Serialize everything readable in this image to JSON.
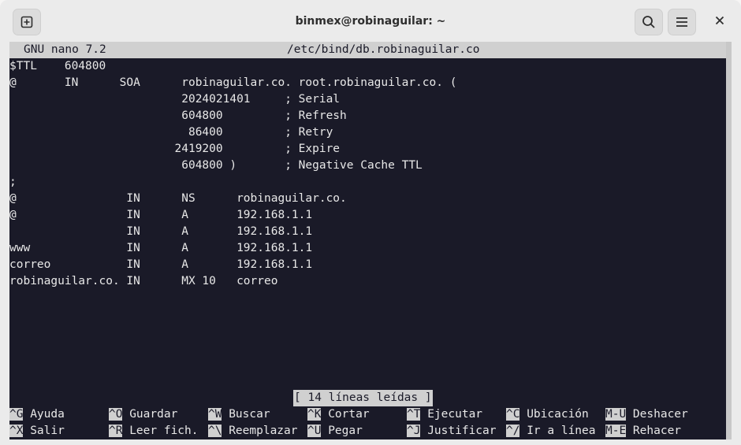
{
  "window": {
    "title": "binmex@robinaguilar: ~"
  },
  "icons": {
    "new_tab": "new-tab-icon",
    "search": "search-icon",
    "menu": "hamburger-menu-icon",
    "close": "close-icon"
  },
  "nano": {
    "version": "GNU nano 7.2",
    "filename": "/etc/bind/db.robinaguilar.co",
    "lines": [
      "$TTL    604800",
      "@       IN      SOA      robinaguilar.co. root.robinaguilar.co. (",
      "                         2024021401     ; Serial",
      "                         604800         ; Refresh",
      "                          86400         ; Retry",
      "                        2419200         ; Expire",
      "                         604800 )       ; Negative Cache TTL",
      ";",
      "@                IN      NS      robinaguilar.co.",
      "@                IN      A       192.168.1.1",
      "                 IN      A       192.168.1.1",
      "www              IN      A       192.168.1.1",
      "correo           IN      A       192.168.1.1",
      "robinaguilar.co. IN      MX 10   correo"
    ],
    "status": "[ 14 líneas leídas ]",
    "shortcuts_row1": [
      {
        "key": "^G",
        "label": " Ayuda"
      },
      {
        "key": "^O",
        "label": " Guardar"
      },
      {
        "key": "^W",
        "label": " Buscar"
      },
      {
        "key": "^K",
        "label": " Cortar"
      },
      {
        "key": "^T",
        "label": " Ejecutar"
      },
      {
        "key": "^C",
        "label": " Ubicación"
      },
      {
        "key": "M-U",
        "label": " Deshacer"
      }
    ],
    "shortcuts_row2": [
      {
        "key": "^X",
        "label": " Salir"
      },
      {
        "key": "^R",
        "label": " Leer fich."
      },
      {
        "key": "^\\",
        "label": " Reemplazar"
      },
      {
        "key": "^U",
        "label": " Pegar"
      },
      {
        "key": "^J",
        "label": " Justificar"
      },
      {
        "key": "^/",
        "label": " Ir a línea"
      },
      {
        "key": "M-E",
        "label": " Rehacer"
      }
    ]
  },
  "colors": {
    "terminal_bg": "#1a1a28",
    "terminal_fg": "#e8e8e8",
    "bar_bg": "#d0d0d0",
    "titlebar_bg": "#ebebeb"
  }
}
